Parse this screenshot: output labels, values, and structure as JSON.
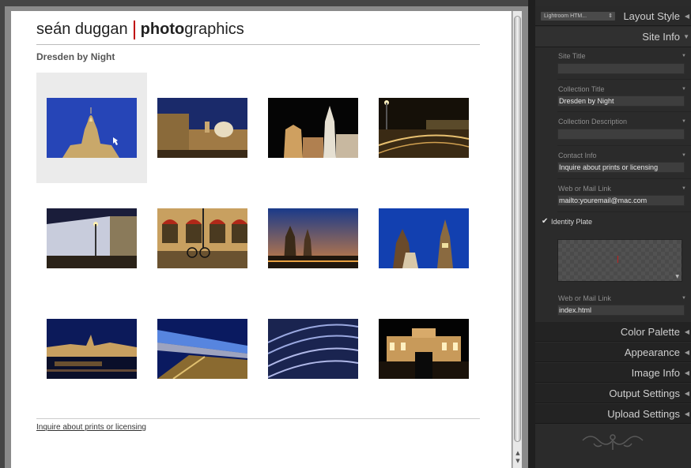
{
  "site": {
    "brand_regular": "seán duggan",
    "brand_bold": "photo",
    "brand_tail": "graphics",
    "collection_title": "Dresden by Night",
    "footer_link": "Inquire about prints or licensing"
  },
  "thumbnails": [
    {
      "name": "frauenkirche-dome",
      "selected": true
    },
    {
      "name": "palace-domes"
    },
    {
      "name": "cathedral-towers"
    },
    {
      "name": "tram-tracks-street"
    },
    {
      "name": "lit-building-lantern"
    },
    {
      "name": "red-awnings-bicycle"
    },
    {
      "name": "dusk-skyline-towers"
    },
    {
      "name": "rathaus-towers"
    },
    {
      "name": "riverside-skyline"
    },
    {
      "name": "tram-light-trails"
    },
    {
      "name": "cobblestone-tracks"
    },
    {
      "name": "palace-gate-night"
    }
  ],
  "panel": {
    "template_select": "Lightroom HTM...",
    "layout_style": "Layout Style",
    "site_info": "Site Info",
    "fields": {
      "site_title_label": "Site Title",
      "site_title_value": "",
      "collection_title_label": "Collection Title",
      "collection_title_value": "Dresden by Night",
      "collection_description_label": "Collection Description",
      "collection_description_value": "",
      "contact_info_label": "Contact Info",
      "contact_info_value": "Inquire about prints or licensing",
      "web_mail_label": "Web or Mail Link",
      "web_mail_value": "mailto:youremail@mac.com",
      "identity_plate_label": "Identity Plate",
      "identity_plate_checked": true,
      "web_mail_label_2": "Web or Mail Link",
      "web_mail_value_2": "index.html"
    },
    "sections": {
      "color_palette": "Color Palette",
      "appearance": "Appearance",
      "image_info": "Image Info",
      "output_settings": "Output Settings",
      "upload_settings": "Upload Settings"
    }
  },
  "icons": {
    "dropdown": "triangle-down-icon",
    "section_toggle": "triangle-left-icon",
    "check": "checkmark-icon"
  }
}
